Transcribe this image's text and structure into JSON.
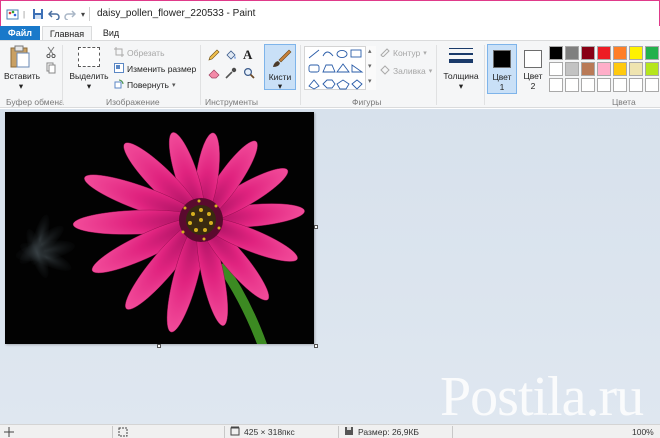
{
  "window": {
    "title": "daisy_pollen_flower_220533 - Paint"
  },
  "tabs": {
    "file": "Файл",
    "home": "Главная",
    "view": "Вид"
  },
  "clipboard": {
    "paste_label": "Вставить",
    "group_label": "Буфер обмена"
  },
  "image": {
    "select_label": "Выделить",
    "crop_label": "Обрезать",
    "resize_label": "Изменить размер",
    "rotate_label": "Повернуть",
    "group_label": "Изображение"
  },
  "tools": {
    "group_label": "Инструменты",
    "brushes_label": "Кисти"
  },
  "shapes": {
    "outline_label": "Контур",
    "fill_label": "Заливка",
    "group_label": "Фигуры"
  },
  "size": {
    "label": "Толщина"
  },
  "colors": {
    "color1_label": "Цвет 1",
    "color1_line1": "Цвет",
    "color1_line2": "1",
    "color2_line1": "Цвет",
    "color2_line2": "2",
    "color1_value": "#000000",
    "color2_value": "#ffffff",
    "group_label": "Цвета",
    "palette": [
      "#000000",
      "#7f7f7f",
      "#880015",
      "#ed1c24",
      "#ff7f27",
      "#fff200",
      "#22b14c",
      "#ffffff",
      "#c3c3c3",
      "#b97a57",
      "#ffaec9",
      "#ffc90e",
      "#efe4b0",
      "#b5e61d",
      "#ffffff",
      "#ffffff",
      "#ffffff",
      "#ffffff",
      "#ffffff",
      "#ffffff",
      "#ffffff"
    ]
  },
  "watermark": {
    "text": "Postila.ru"
  },
  "status": {
    "dimensions": "425 × 318пкс",
    "size": "Размер: 26,9КБ",
    "zoom": "100%"
  }
}
